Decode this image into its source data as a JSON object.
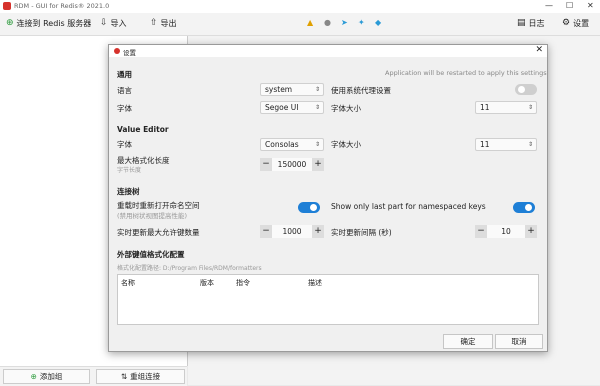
{
  "window": {
    "title": "RDM - GUI for Redis® 2021.0"
  },
  "toolbar": {
    "connect_label": "连接到 Redis 服务器",
    "import_label": "导入",
    "export_label": "导出",
    "log_label": "日志",
    "settings_label": "设置"
  },
  "bottom": {
    "add_group_label": "添加组",
    "reorder_label": "重组连接"
  },
  "dialog": {
    "title": "设置",
    "restart_notice": "Application will be restarted to apply this settings",
    "general": {
      "heading": "通用",
      "language_label": "语言",
      "language_value": "system",
      "font_label": "字体",
      "font_value": "Segoe UI",
      "proxy_label": "使用系统代理设置",
      "proxy_enabled": false,
      "font_size_label": "字体大小",
      "font_size_value": "11"
    },
    "value_editor": {
      "heading": "Value Editor",
      "font_label": "字体",
      "font_value": "Consolas",
      "font_size_label": "字体大小",
      "font_size_value": "11",
      "max_format_label": "最大格式化长度",
      "max_format_hint": "字节长度",
      "max_format_value": "150000"
    },
    "connections": {
      "heading": "连接树",
      "reopen_label": "重载时重新打开命名空间",
      "reopen_hint": "(禁用树状视图提高性能)",
      "reopen_enabled": true,
      "ns_last_part_label": "Show only last part for namespaced keys",
      "ns_last_part_enabled": true,
      "max_keys_label": "实时更新最大允许键数量",
      "max_keys_value": "1000",
      "live_interval_label": "实时更新间隔 (秒)",
      "live_interval_value": "10"
    },
    "formatters": {
      "heading": "外部键值格式化配置",
      "path_label": "格式化配置路径: D:/Program Files/RDM/formatters",
      "columns": [
        "名称",
        "版本",
        "指令",
        "描述"
      ]
    },
    "ok_label": "确定",
    "cancel_label": "取消"
  },
  "colors": {
    "accent": "#1e7fd6",
    "brand": "#d6322c"
  }
}
